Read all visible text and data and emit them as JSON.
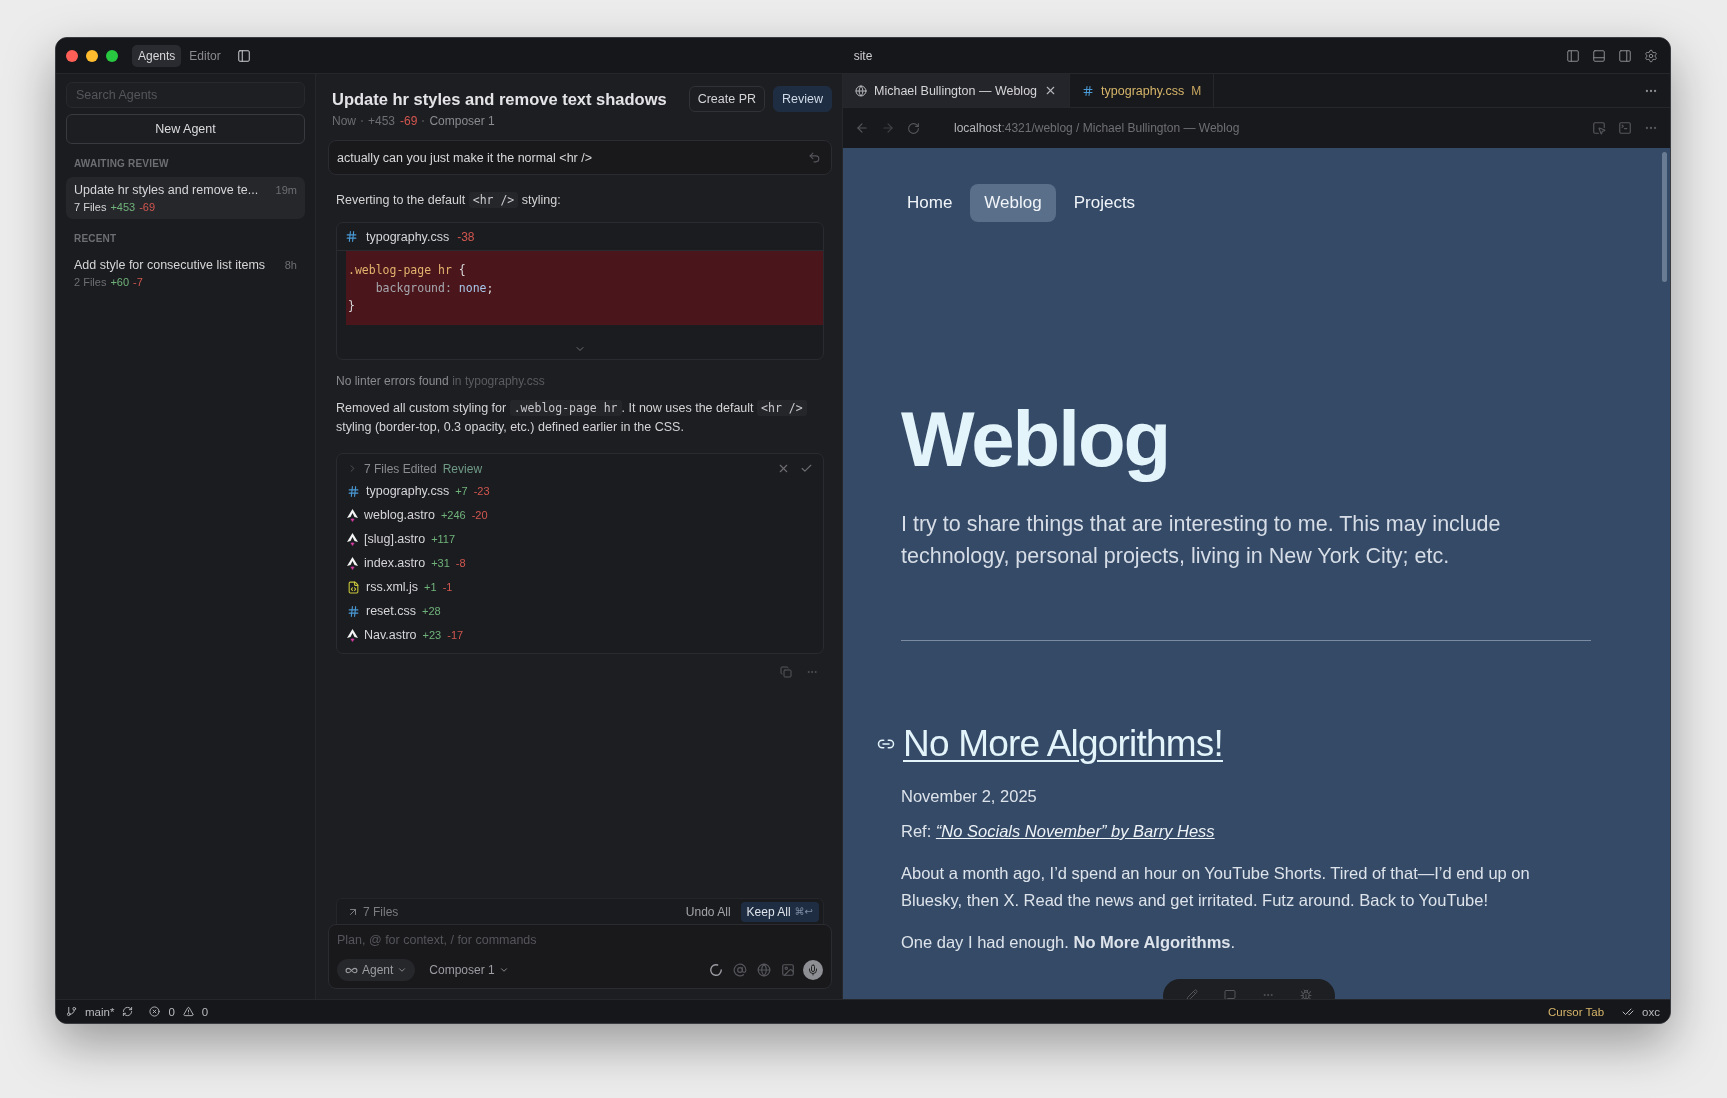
{
  "window": {
    "title": "site"
  },
  "mode_tabs": [
    {
      "label": "Agents",
      "selected": true
    },
    {
      "label": "Editor",
      "selected": false
    }
  ],
  "sidebar": {
    "search": {
      "placeholder": "Search Agents"
    },
    "new_button": "New Agent",
    "sections": [
      {
        "heading": "AWAITING REVIEW",
        "items": [
          {
            "title": "Update hr styles and remove te...",
            "time": "19m",
            "files": "7 Files",
            "added": "+453",
            "removed": "-69",
            "selected": true
          }
        ]
      },
      {
        "heading": "RECENT",
        "items": [
          {
            "title": "Add style for consecutive list items",
            "time": "8h",
            "files": "2 Files",
            "added": "+60",
            "removed": "-7",
            "selected": false
          }
        ]
      }
    ]
  },
  "chat": {
    "title": "Update hr styles and remove text shadows",
    "actions": [
      {
        "label": "Create PR",
        "kind": "secondary"
      },
      {
        "label": "Review",
        "kind": "primary"
      }
    ],
    "meta": {
      "time": "Now",
      "added": "+453",
      "removed": "-69",
      "model": "Composer 1"
    },
    "user_message": "actually can you just make it the normal <hr />",
    "reply_intro": [
      {
        "text": "Reverting to the default ",
        "code": false
      },
      {
        "text": "<hr />",
        "code": true
      },
      {
        "text": " styling:",
        "code": false
      }
    ],
    "diff": {
      "file": "typography.css",
      "removed": "-38",
      "lines": [
        [
          {
            "text": ".weblog-page hr",
            "kind": "selector"
          },
          {
            "text": " {",
            "kind": "punct"
          }
        ],
        [
          {
            "text": "    background:",
            "kind": "property"
          },
          {
            "text": " none",
            "kind": "value"
          },
          {
            "text": ";",
            "kind": "punct"
          }
        ],
        [
          {
            "text": "}",
            "kind": "punct"
          }
        ]
      ]
    },
    "lint": {
      "text": "No linter errors found",
      "file": "in typography.css"
    },
    "summary": [
      {
        "text": "Removed all custom styling for ",
        "code": false
      },
      {
        "text": ".weblog-page hr",
        "code": true
      },
      {
        "text": ". It now uses the default ",
        "code": false
      },
      {
        "text": "<hr />",
        "code": true
      },
      {
        "text": " styling (border-top, 0.3 opacity, etc.) defined earlier in the CSS.",
        "code": false
      }
    ],
    "files_edited": {
      "label": "7 Files Edited",
      "review": "Review",
      "files": [
        {
          "name": "typography.css",
          "kind": "css",
          "added": "+7",
          "removed": "-23"
        },
        {
          "name": "weblog.astro",
          "kind": "astro",
          "added": "+246",
          "removed": "-20"
        },
        {
          "name": "[slug].astro",
          "kind": "astro",
          "added": "+117"
        },
        {
          "name": "index.astro",
          "kind": "astro",
          "added": "+31",
          "removed": "-8"
        },
        {
          "name": "rss.xml.js",
          "kind": "js",
          "added": "+1",
          "removed": "-1"
        },
        {
          "name": "reset.css",
          "kind": "css",
          "added": "+28"
        },
        {
          "name": "Nav.astro",
          "kind": "astro",
          "added": "+23",
          "removed": "-17"
        }
      ]
    },
    "pending": {
      "label": "7 Files",
      "undo": "Undo All",
      "keep": "Keep All",
      "shortcut": "⌘↩"
    },
    "composer": {
      "placeholder": "Plan, @ for context, / for commands",
      "mode": "Agent",
      "model": "Composer 1"
    }
  },
  "browser": {
    "tabs": [
      {
        "label": "Michael Bullington — Weblog",
        "kind": "web",
        "selected": true
      },
      {
        "label": "typography.css",
        "kind": "css",
        "selected": false,
        "badge": "M"
      }
    ],
    "url": {
      "host": "localhost",
      "path": ":4321/weblog",
      "title": "/ Michael Bullington — Weblog"
    },
    "page": {
      "nav": [
        {
          "label": "Home",
          "selected": false
        },
        {
          "label": "Weblog",
          "selected": true
        },
        {
          "label": "Projects",
          "selected": false
        }
      ],
      "heading": "Weblog",
      "intro": "I try to share things that are interesting to me. This may include technology, personal projects, living in New York City; etc.",
      "post": {
        "title": "No More Algorithms!",
        "date": "November 2, 2025",
        "ref_label": "Ref:",
        "ref_link": "“No Socials November” by Barry Hess",
        "paragraphs": [
          "About a month ago, I’d spend an hour on YouTube Shorts. Tired of that—I’d end up on Bluesky, then X. Read the news and get irritated. Futz around. Back to YouTube!",
          "One day I had enough. **No More Algorithms**."
        ]
      }
    }
  },
  "status_bar": {
    "branch": "main*",
    "errors": "0",
    "warnings": "0",
    "right": [
      "Cursor Tab",
      "oxc"
    ]
  }
}
